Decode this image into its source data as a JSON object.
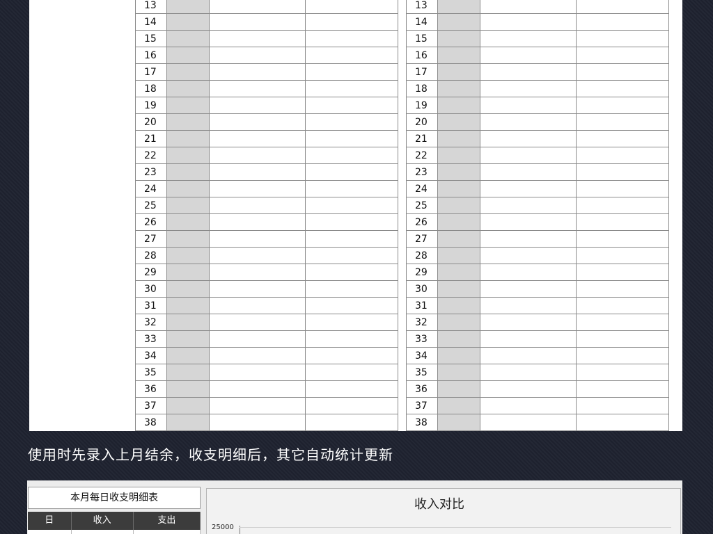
{
  "rows": [
    "13",
    "14",
    "15",
    "16",
    "17",
    "18",
    "19",
    "20",
    "21",
    "22",
    "23",
    "24",
    "25",
    "26",
    "27",
    "28",
    "29",
    "30",
    "31",
    "32",
    "33",
    "34",
    "35",
    "36",
    "37",
    "38"
  ],
  "caption": "使用时先录入上月结余，收支明细后，其它自动统计更新",
  "summary": {
    "title": "本月每日收支明细表",
    "headers": [
      "日",
      "收入",
      "支出"
    ]
  },
  "chart_data": {
    "type": "bar",
    "title": "收入对比",
    "y_ticks": [
      "25000"
    ]
  }
}
